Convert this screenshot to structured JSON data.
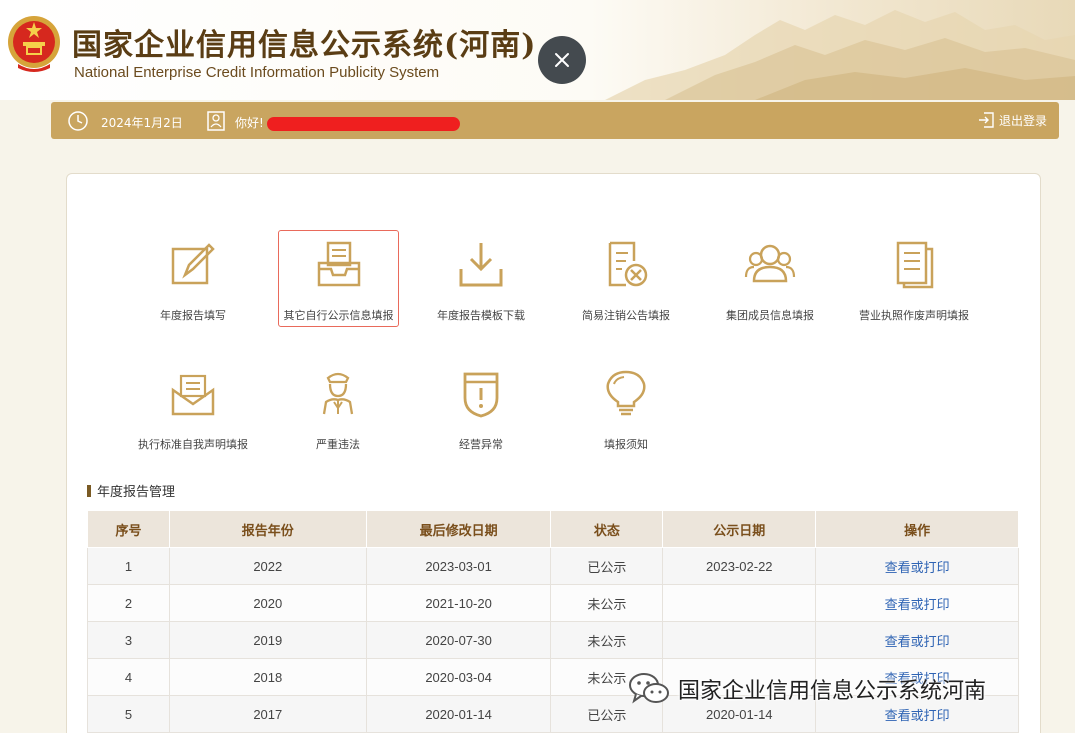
{
  "header": {
    "title_cn": "国家企业信用信息公示系统(河南)",
    "title_en": "National Enterprise Credit Information Publicity System"
  },
  "topbar": {
    "date": "2024年1月2日",
    "greeting": "你好!",
    "logout": "退出登录"
  },
  "colors": {
    "brand_gold": "#c9a560",
    "icon_gold": "#c9a25a",
    "link_blue": "#2f64b4",
    "redaction_red": "#ef1f1f"
  },
  "tiles": [
    {
      "label": "年度报告填写",
      "icon": "edit-report-icon"
    },
    {
      "label": "其它自行公示信息填报",
      "icon": "inbox-document-icon",
      "selected": true
    },
    {
      "label": "年度报告模板下载",
      "icon": "download-icon"
    },
    {
      "label": "简易注销公告填报",
      "icon": "document-cancel-icon"
    },
    {
      "label": "集团成员信息填报",
      "icon": "group-members-icon"
    },
    {
      "label": "营业执照作废声明填报",
      "icon": "license-document-icon"
    },
    {
      "label": "执行标准自我声明填报",
      "icon": "envelope-icon"
    },
    {
      "label": "严重违法",
      "icon": "officer-icon"
    },
    {
      "label": "经营异常",
      "icon": "alert-shield-icon"
    },
    {
      "label": "填报须知",
      "icon": "lightbulb-icon"
    }
  ],
  "annual_reports": {
    "section_title": "年度报告管理",
    "columns": [
      "序号",
      "报告年份",
      "最后修改日期",
      "状态",
      "公示日期",
      "操作"
    ],
    "rows": [
      {
        "no": "1",
        "year": "2022",
        "modified": "2023-03-01",
        "status": "已公示",
        "public_date": "2023-02-22",
        "action": "查看或打印"
      },
      {
        "no": "2",
        "year": "2020",
        "modified": "2021-10-20",
        "status": "未公示",
        "public_date": "",
        "action": "查看或打印"
      },
      {
        "no": "3",
        "year": "2019",
        "modified": "2020-07-30",
        "status": "未公示",
        "public_date": "",
        "action": "查看或打印"
      },
      {
        "no": "4",
        "year": "2018",
        "modified": "2020-03-04",
        "status": "未公示",
        "public_date": "",
        "action": "查看或打印"
      },
      {
        "no": "5",
        "year": "2017",
        "modified": "2020-01-14",
        "status": "已公示",
        "public_date": "2020-01-14",
        "action": "查看或打印"
      }
    ]
  },
  "watermark": {
    "text": "国家企业信用信息公示系统河南",
    "icon": "wechat-icon"
  }
}
